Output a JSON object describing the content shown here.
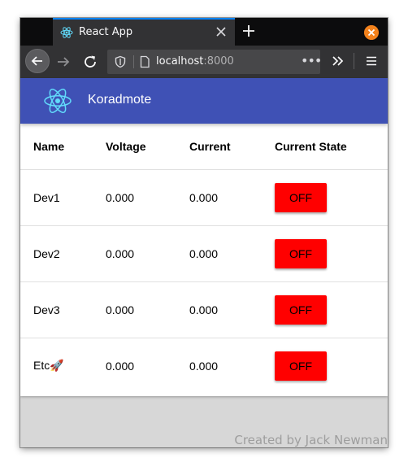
{
  "browser": {
    "tab_title": "React App",
    "url_host": "localhost",
    "url_port": ":8000",
    "page_actions_label": "•••"
  },
  "app": {
    "title": "Koradmote",
    "brand_color": "#3f51b5",
    "logo_icon": "react-atom-icon"
  },
  "table": {
    "columns": [
      "Name",
      "Voltage",
      "Current",
      "Current State"
    ],
    "rows": [
      {
        "name": "Dev1",
        "voltage": "0.000",
        "current": "0.000",
        "state": "OFF"
      },
      {
        "name": "Dev2",
        "voltage": "0.000",
        "current": "0.000",
        "state": "OFF"
      },
      {
        "name": "Dev3",
        "voltage": "0.000",
        "current": "0.000",
        "state": "OFF"
      },
      {
        "name": "Etc🚀",
        "voltage": "0.000",
        "current": "0.000",
        "state": "OFF"
      }
    ],
    "off_color": "#ff0000"
  },
  "footer": {
    "credit": "Created by Jack Newman"
  }
}
